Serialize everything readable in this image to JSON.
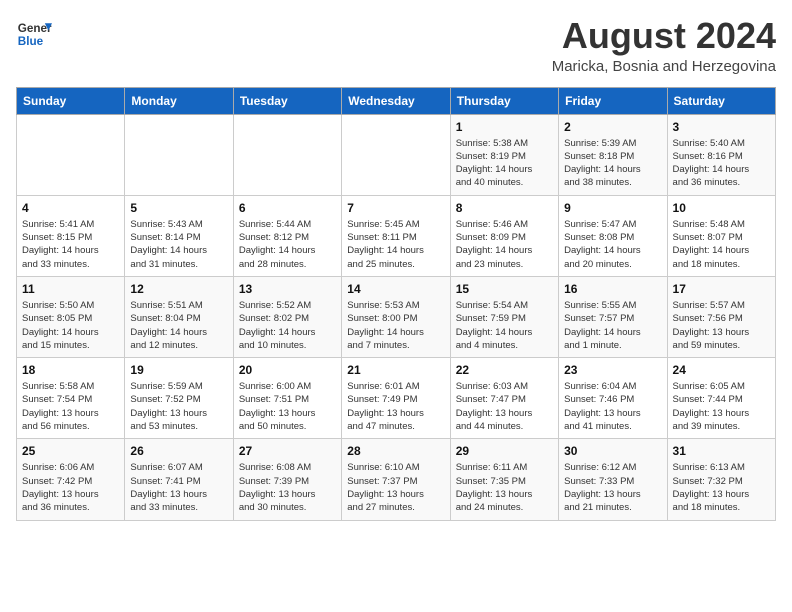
{
  "header": {
    "logo_general": "General",
    "logo_blue": "Blue",
    "main_title": "August 2024",
    "subtitle": "Maricka, Bosnia and Herzegovina"
  },
  "calendar": {
    "days_of_week": [
      "Sunday",
      "Monday",
      "Tuesday",
      "Wednesday",
      "Thursday",
      "Friday",
      "Saturday"
    ],
    "weeks": [
      [
        {
          "day": "",
          "info": ""
        },
        {
          "day": "",
          "info": ""
        },
        {
          "day": "",
          "info": ""
        },
        {
          "day": "",
          "info": ""
        },
        {
          "day": "1",
          "info": "Sunrise: 5:38 AM\nSunset: 8:19 PM\nDaylight: 14 hours\nand 40 minutes."
        },
        {
          "day": "2",
          "info": "Sunrise: 5:39 AM\nSunset: 8:18 PM\nDaylight: 14 hours\nand 38 minutes."
        },
        {
          "day": "3",
          "info": "Sunrise: 5:40 AM\nSunset: 8:16 PM\nDaylight: 14 hours\nand 36 minutes."
        }
      ],
      [
        {
          "day": "4",
          "info": "Sunrise: 5:41 AM\nSunset: 8:15 PM\nDaylight: 14 hours\nand 33 minutes."
        },
        {
          "day": "5",
          "info": "Sunrise: 5:43 AM\nSunset: 8:14 PM\nDaylight: 14 hours\nand 31 minutes."
        },
        {
          "day": "6",
          "info": "Sunrise: 5:44 AM\nSunset: 8:12 PM\nDaylight: 14 hours\nand 28 minutes."
        },
        {
          "day": "7",
          "info": "Sunrise: 5:45 AM\nSunset: 8:11 PM\nDaylight: 14 hours\nand 25 minutes."
        },
        {
          "day": "8",
          "info": "Sunrise: 5:46 AM\nSunset: 8:09 PM\nDaylight: 14 hours\nand 23 minutes."
        },
        {
          "day": "9",
          "info": "Sunrise: 5:47 AM\nSunset: 8:08 PM\nDaylight: 14 hours\nand 20 minutes."
        },
        {
          "day": "10",
          "info": "Sunrise: 5:48 AM\nSunset: 8:07 PM\nDaylight: 14 hours\nand 18 minutes."
        }
      ],
      [
        {
          "day": "11",
          "info": "Sunrise: 5:50 AM\nSunset: 8:05 PM\nDaylight: 14 hours\nand 15 minutes."
        },
        {
          "day": "12",
          "info": "Sunrise: 5:51 AM\nSunset: 8:04 PM\nDaylight: 14 hours\nand 12 minutes."
        },
        {
          "day": "13",
          "info": "Sunrise: 5:52 AM\nSunset: 8:02 PM\nDaylight: 14 hours\nand 10 minutes."
        },
        {
          "day": "14",
          "info": "Sunrise: 5:53 AM\nSunset: 8:00 PM\nDaylight: 14 hours\nand 7 minutes."
        },
        {
          "day": "15",
          "info": "Sunrise: 5:54 AM\nSunset: 7:59 PM\nDaylight: 14 hours\nand 4 minutes."
        },
        {
          "day": "16",
          "info": "Sunrise: 5:55 AM\nSunset: 7:57 PM\nDaylight: 14 hours\nand 1 minute."
        },
        {
          "day": "17",
          "info": "Sunrise: 5:57 AM\nSunset: 7:56 PM\nDaylight: 13 hours\nand 59 minutes."
        }
      ],
      [
        {
          "day": "18",
          "info": "Sunrise: 5:58 AM\nSunset: 7:54 PM\nDaylight: 13 hours\nand 56 minutes."
        },
        {
          "day": "19",
          "info": "Sunrise: 5:59 AM\nSunset: 7:52 PM\nDaylight: 13 hours\nand 53 minutes."
        },
        {
          "day": "20",
          "info": "Sunrise: 6:00 AM\nSunset: 7:51 PM\nDaylight: 13 hours\nand 50 minutes."
        },
        {
          "day": "21",
          "info": "Sunrise: 6:01 AM\nSunset: 7:49 PM\nDaylight: 13 hours\nand 47 minutes."
        },
        {
          "day": "22",
          "info": "Sunrise: 6:03 AM\nSunset: 7:47 PM\nDaylight: 13 hours\nand 44 minutes."
        },
        {
          "day": "23",
          "info": "Sunrise: 6:04 AM\nSunset: 7:46 PM\nDaylight: 13 hours\nand 41 minutes."
        },
        {
          "day": "24",
          "info": "Sunrise: 6:05 AM\nSunset: 7:44 PM\nDaylight: 13 hours\nand 39 minutes."
        }
      ],
      [
        {
          "day": "25",
          "info": "Sunrise: 6:06 AM\nSunset: 7:42 PM\nDaylight: 13 hours\nand 36 minutes."
        },
        {
          "day": "26",
          "info": "Sunrise: 6:07 AM\nSunset: 7:41 PM\nDaylight: 13 hours\nand 33 minutes."
        },
        {
          "day": "27",
          "info": "Sunrise: 6:08 AM\nSunset: 7:39 PM\nDaylight: 13 hours\nand 30 minutes."
        },
        {
          "day": "28",
          "info": "Sunrise: 6:10 AM\nSunset: 7:37 PM\nDaylight: 13 hours\nand 27 minutes."
        },
        {
          "day": "29",
          "info": "Sunrise: 6:11 AM\nSunset: 7:35 PM\nDaylight: 13 hours\nand 24 minutes."
        },
        {
          "day": "30",
          "info": "Sunrise: 6:12 AM\nSunset: 7:33 PM\nDaylight: 13 hours\nand 21 minutes."
        },
        {
          "day": "31",
          "info": "Sunrise: 6:13 AM\nSunset: 7:32 PM\nDaylight: 13 hours\nand 18 minutes."
        }
      ]
    ]
  }
}
